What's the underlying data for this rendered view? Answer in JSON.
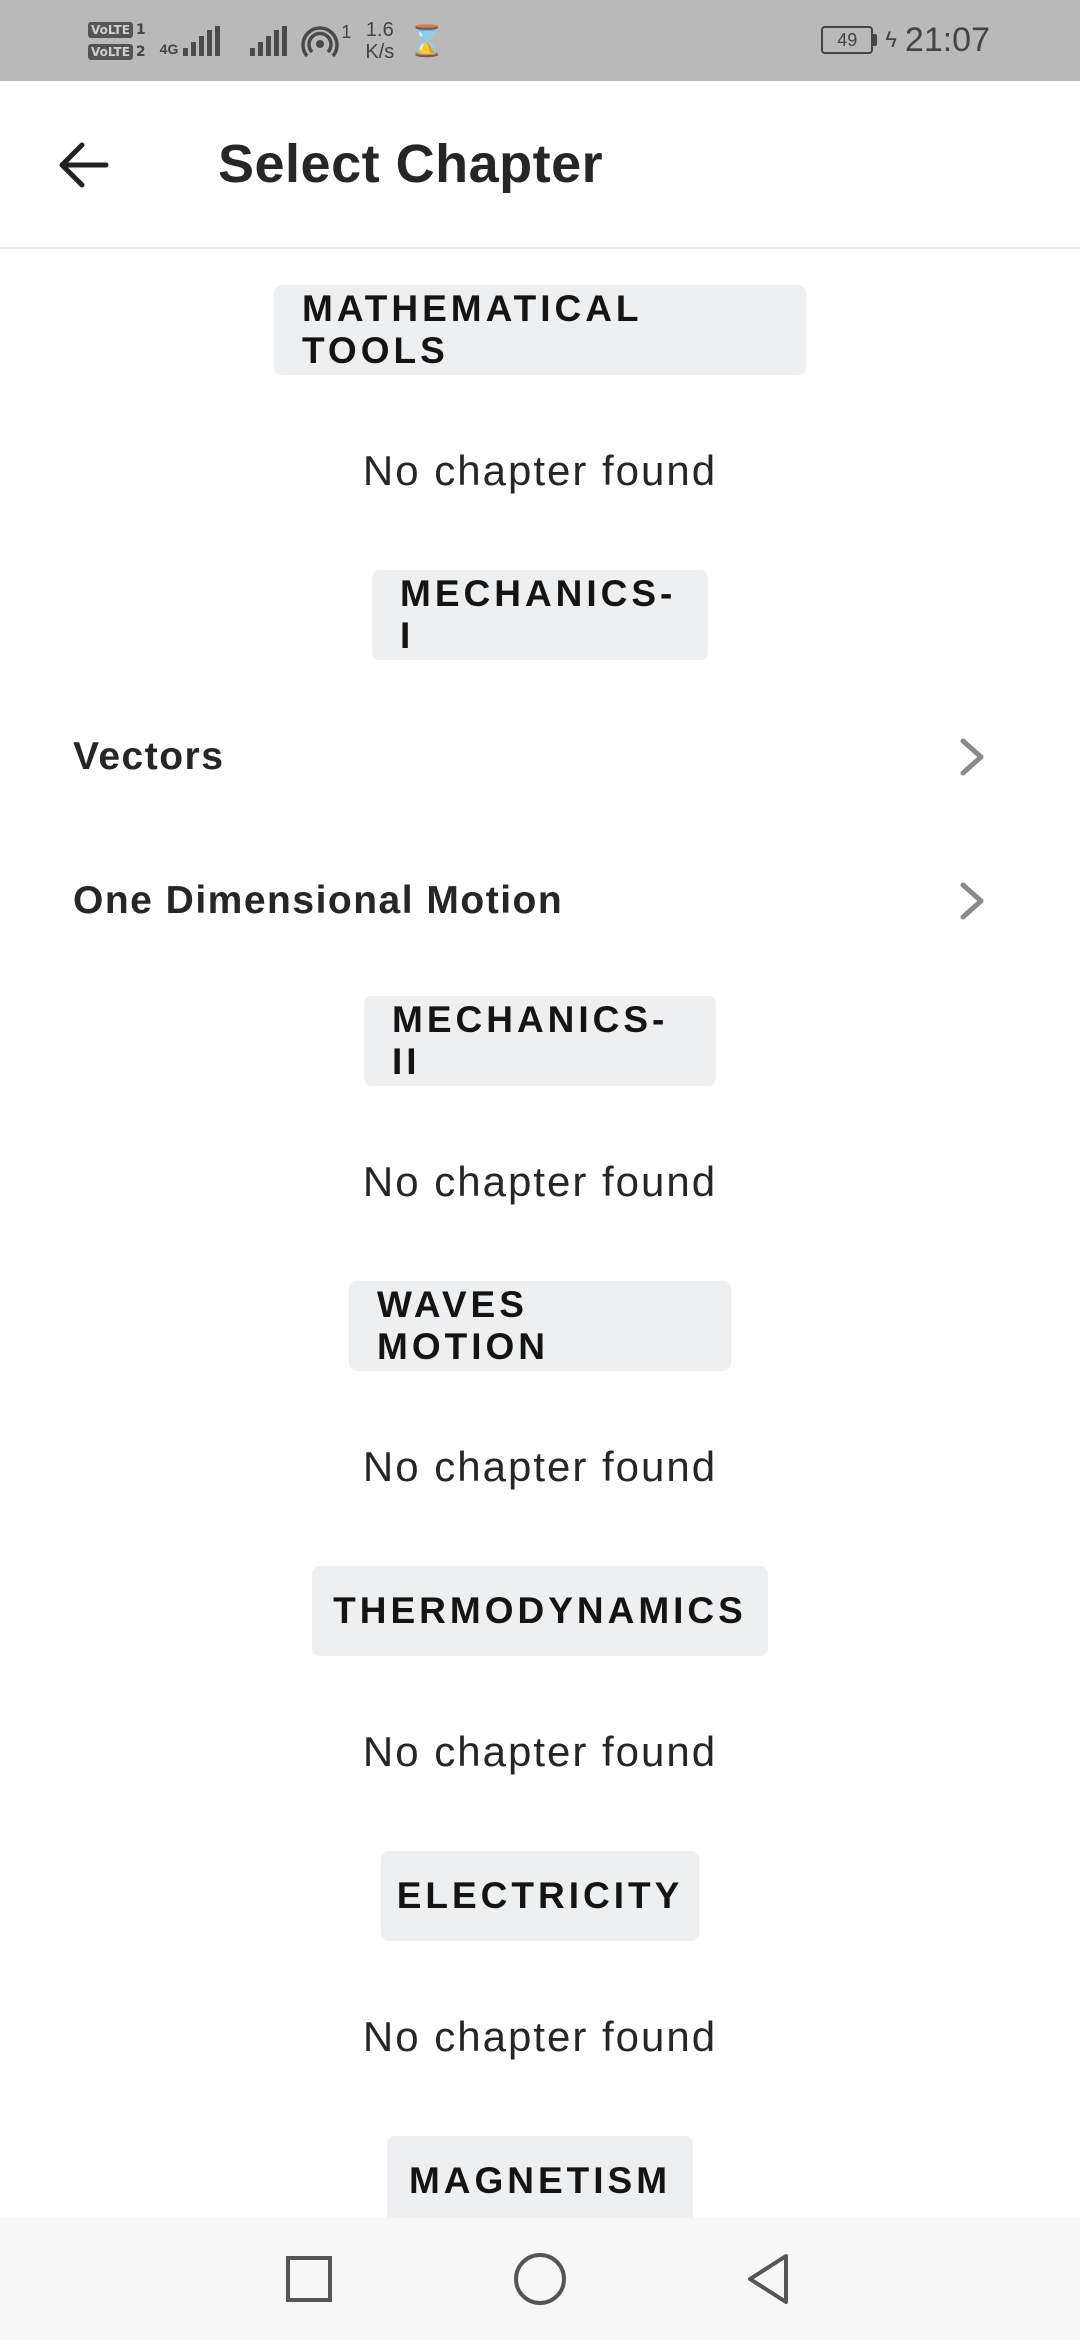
{
  "status_bar": {
    "sim1": "VoLTE",
    "sim1_slot": "1",
    "sim2": "VoLTE",
    "sim2_slot": "2",
    "network_type": "4G",
    "hotspot_count": "1",
    "speed_value": "1.6",
    "speed_unit": "K/s",
    "battery": "49",
    "time": "21:07"
  },
  "header": {
    "title": "Select Chapter"
  },
  "sections": [
    {
      "title": "MATHEMATICAL TOOLS",
      "empty_text": "No chapter found",
      "chapters": []
    },
    {
      "title": "MECHANICS-I",
      "chapters": [
        "Vectors",
        "One Dimensional Motion"
      ]
    },
    {
      "title": "MECHANICS-II",
      "empty_text": "No chapter found",
      "chapters": []
    },
    {
      "title": "WAVES MOTION",
      "empty_text": "No chapter found",
      "chapters": []
    },
    {
      "title": "THERMODYNAMICS",
      "empty_text": "No chapter found",
      "chapters": []
    },
    {
      "title": "ELECTRICITY",
      "empty_text": "No chapter found",
      "chapters": []
    },
    {
      "title": "MAGNETISM",
      "chapters": []
    }
  ],
  "icons": {
    "back": "arrow-left-icon",
    "chevron": "chevron-right-icon",
    "nav_recents": "square-icon",
    "nav_home": "circle-icon",
    "nav_back": "triangle-back-icon"
  },
  "colors": {
    "status_bar_bg": "#b9b9b9",
    "pill_bg": "#edeff1",
    "text": "#262626",
    "chevron": "#8a8a8a"
  }
}
